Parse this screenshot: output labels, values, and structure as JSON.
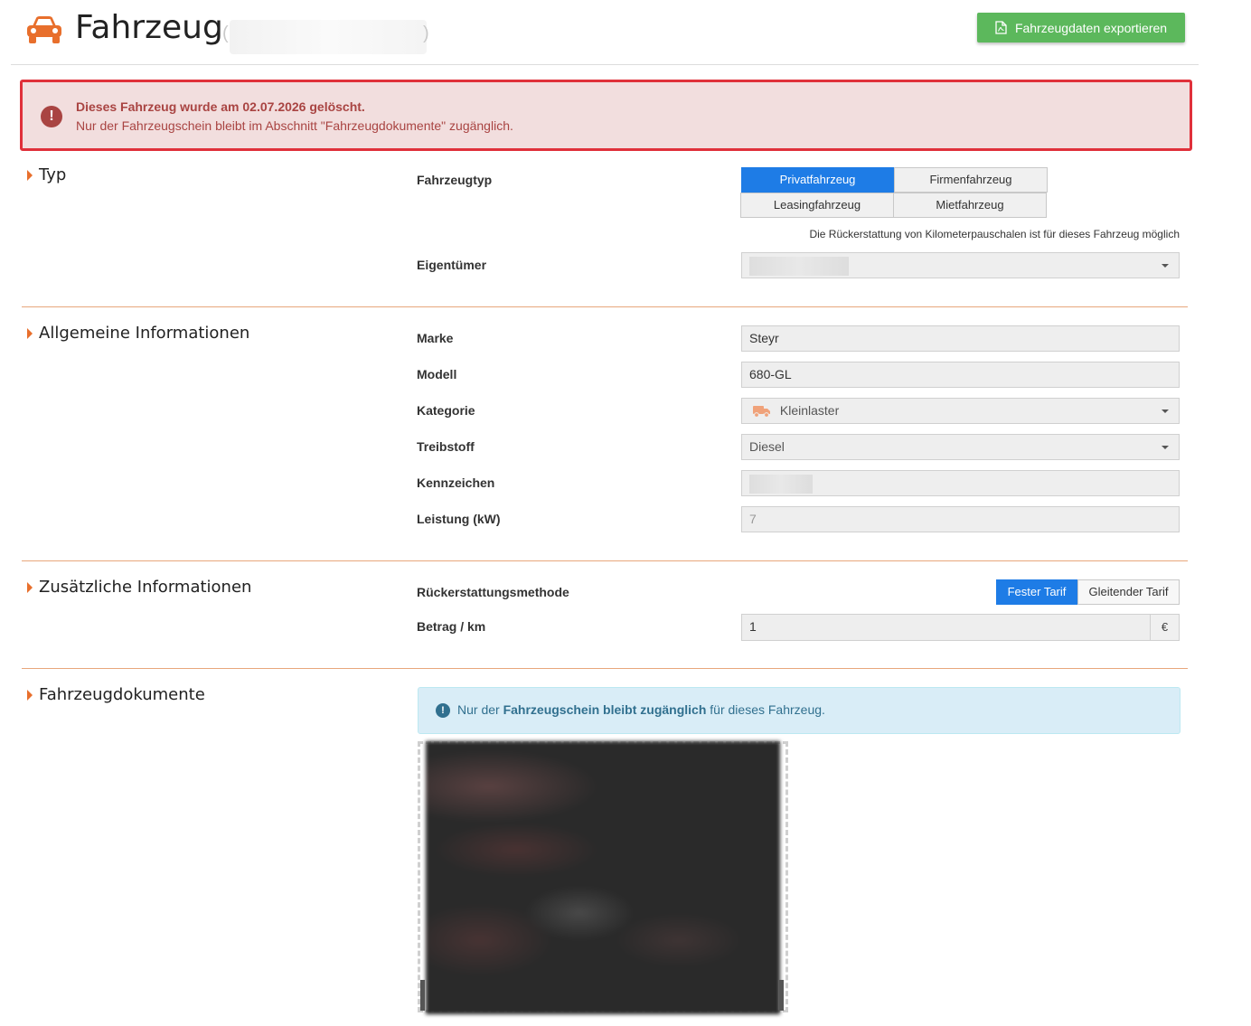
{
  "header": {
    "title": "Fahrzeug",
    "title_paren_open": "(",
    "title_paren_close": ")",
    "export_label": "Fahrzeugdaten exportieren",
    "icon": "car-icon",
    "accent_color": "#e86f2c"
  },
  "alert": {
    "line1": "Dieses Fahrzeug wurde am 02.07.2026 gelöscht.",
    "line2": "Nur der Fahrzeugschein bleibt im Abschnitt \"Fahrzeugdokumente\" zugänglich.",
    "icon": "exclamation-circle-icon",
    "color": "#a94442"
  },
  "sections": {
    "typ": {
      "title": "Typ",
      "fahrzeugtyp_label": "Fahrzeugtyp",
      "options": [
        "Privatfahrzeug",
        "Firmenfahrzeug",
        "Leasingfahrzeug",
        "Mietfahrzeug"
      ],
      "selected": "Privatfahrzeug",
      "hint": "Die Rückerstattung von Kilometerpauschalen ist für dieses Fahrzeug möglich",
      "eigentuemer_label": "Eigentümer"
    },
    "allgemein": {
      "title": "Allgemeine Informationen",
      "marke_label": "Marke",
      "marke_value": "Steyr",
      "modell_label": "Modell",
      "modell_value": "680-GL",
      "kategorie_label": "Kategorie",
      "kategorie_value": "Kleinlaster",
      "kategorie_icon": "truck-icon",
      "treibstoff_label": "Treibstoff",
      "treibstoff_value": "Diesel",
      "kennzeichen_label": "Kennzeichen",
      "leistung_label": "Leistung (kW)",
      "leistung_placeholder": "7"
    },
    "zusaetzlich": {
      "title": "Zusätzliche Informationen",
      "methode_label": "Rückerstattungsmethode",
      "methode_options": [
        "Fester Tarif",
        "Gleitender Tarif"
      ],
      "methode_selected": "Fester Tarif",
      "betrag_label": "Betrag / km",
      "betrag_value": "1",
      "currency": "€"
    },
    "dokumente": {
      "title": "Fahrzeugdokumente",
      "info_prefix": "Nur der",
      "info_bold": "Fahrzeugschein bleibt zugänglich",
      "info_suffix": "für dieses Fahrzeug.",
      "info_icon": "exclamation-circle-icon"
    }
  }
}
